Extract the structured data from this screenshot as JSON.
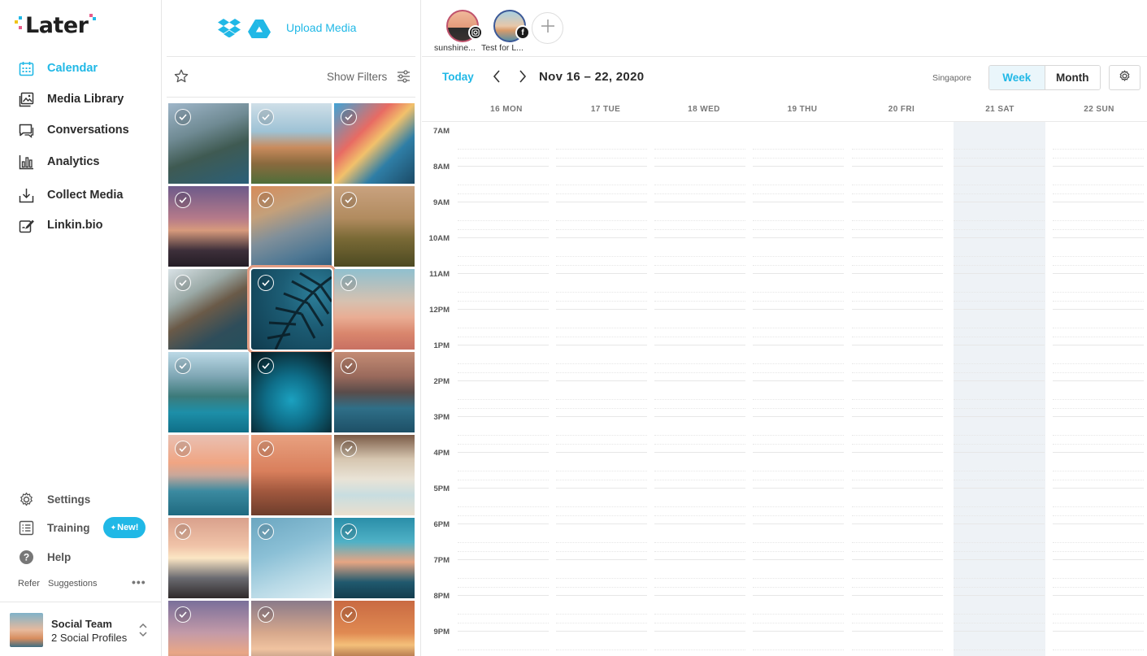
{
  "app": {
    "logo_text": "Later"
  },
  "sidebar": {
    "items": [
      {
        "label": "Calendar",
        "icon": "calendar-icon",
        "active": true
      },
      {
        "label": "Media Library",
        "icon": "image-icon",
        "active": false
      },
      {
        "label": "Conversations",
        "icon": "chat-icon",
        "active": false
      },
      {
        "label": "Analytics",
        "icon": "bar-chart-icon",
        "active": false
      },
      {
        "label": "Collect Media",
        "icon": "download-icon",
        "active": false
      },
      {
        "label": "Linkin.bio",
        "icon": "link-edit-icon",
        "active": false
      }
    ],
    "secondary": [
      {
        "label": "Settings",
        "icon": "gear-icon"
      },
      {
        "label": "Training",
        "icon": "list-icon",
        "badge": "New!"
      },
      {
        "label": "Help",
        "icon": "help-icon"
      }
    ],
    "footer_links": {
      "refer": "Refer",
      "suggestions": "Suggestions"
    },
    "team": {
      "name": "Social Team",
      "profiles": "2 Social Profiles"
    }
  },
  "media": {
    "upload_label": "Upload Media",
    "show_filters": "Show Filters"
  },
  "calendar": {
    "profiles": [
      {
        "label": "sunshine...",
        "network": "instagram"
      },
      {
        "label": "Test for L...",
        "network": "facebook"
      }
    ],
    "today_label": "Today",
    "range": "Nov 16 – 22, 2020",
    "timezone": "Singapore",
    "views": {
      "week": "Week",
      "month": "Month",
      "selected": "Week"
    },
    "days": [
      "16 MON",
      "17 TUE",
      "18 WED",
      "19 THU",
      "20 FRI",
      "21 SAT",
      "22 SUN"
    ],
    "highlighted_day": "21 SAT",
    "hours": [
      "7AM",
      "8AM",
      "9AM",
      "10AM",
      "11AM",
      "12PM",
      "1PM",
      "2PM",
      "3PM",
      "4PM",
      "5PM",
      "6PM",
      "7PM",
      "8PM",
      "9PM"
    ]
  },
  "colors": {
    "accent": "#20b8e6",
    "selected_outline": "#e39f86",
    "weekend_shade": "#eef2f6"
  }
}
